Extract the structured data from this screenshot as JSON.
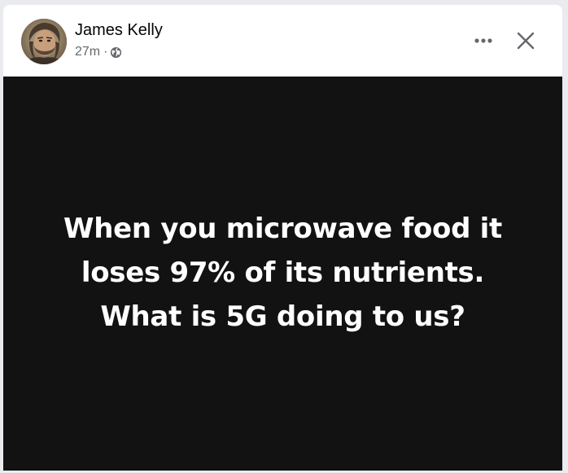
{
  "post": {
    "author": "James Kelly",
    "timestamp": "27m",
    "separator": "·",
    "audience_icon": "globe-icon",
    "image_text": {
      "line1": "When you microwave food it",
      "line2": "loses 97% of its nutrients.",
      "line3": "What is 5G doing to us?"
    }
  },
  "header_actions": {
    "more_icon": "more-options-icon",
    "close_icon": "close-icon"
  },
  "colors": {
    "image_background": "#121212",
    "image_text": "#ffffff",
    "name_text": "#050505",
    "meta_text": "#65676b",
    "icon": "#65676b"
  }
}
